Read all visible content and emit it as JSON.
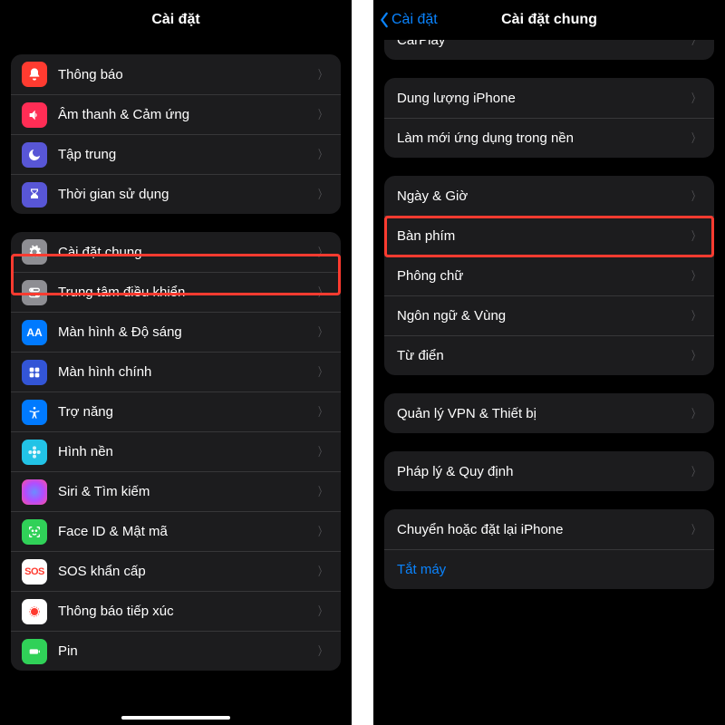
{
  "left": {
    "title": "Cài đặt",
    "group1": [
      {
        "key": "notifications",
        "label": "Thông báo",
        "iconBg": "#ff3b30",
        "glyph": "bell"
      },
      {
        "key": "sound-haptics",
        "label": "Âm thanh & Cảm ứng",
        "iconBg": "#ff2d55",
        "glyph": "speaker"
      },
      {
        "key": "focus",
        "label": "Tập trung",
        "iconBg": "#5856d6",
        "glyph": "moon"
      },
      {
        "key": "screentime",
        "label": "Thời gian sử dụng",
        "iconBg": "#5856d6",
        "glyph": "hourglass"
      }
    ],
    "group2": [
      {
        "key": "general",
        "label": "Cài đặt chung",
        "iconBg": "#8e8e93",
        "glyph": "gear",
        "highlight": true
      },
      {
        "key": "control-center",
        "label": "Trung tâm điều khiển",
        "iconBg": "#8e8e93",
        "glyph": "switches"
      },
      {
        "key": "display",
        "label": "Màn hình & Độ sáng",
        "iconBg": "#007aff",
        "glyph": "AA"
      },
      {
        "key": "home-screen",
        "label": "Màn hình chính",
        "iconBg": "#3355d6",
        "glyph": "grid"
      },
      {
        "key": "accessibility",
        "label": "Trợ năng",
        "iconBg": "#007aff",
        "glyph": "person"
      },
      {
        "key": "wallpaper",
        "label": "Hình nền",
        "iconBg": "#22c3e6",
        "glyph": "flower"
      },
      {
        "key": "siri",
        "label": "Siri & Tìm kiếm",
        "iconBg": "#1c1c1e",
        "glyph": "siri"
      },
      {
        "key": "faceid",
        "label": "Face ID & Mật mã",
        "iconBg": "#30d158",
        "glyph": "face"
      },
      {
        "key": "sos",
        "label": "SOS khẩn cấp",
        "iconBg": "#ffffff",
        "glyph": "sos"
      },
      {
        "key": "exposure",
        "label": "Thông báo tiếp xúc",
        "iconBg": "#ff3b30",
        "glyph": "exposure"
      },
      {
        "key": "battery",
        "label": "Pin",
        "iconBg": "#30d158",
        "glyph": "battery"
      }
    ]
  },
  "right": {
    "back": "Cài đặt",
    "title": "Cài đặt chung",
    "groupTopCut": [
      {
        "key": "carplay",
        "label": "CarPlay"
      }
    ],
    "groupStorage": [
      {
        "key": "iphone-storage",
        "label": "Dung lượng iPhone"
      },
      {
        "key": "background-refresh",
        "label": "Làm mới ứng dụng trong nền"
      }
    ],
    "groupLang": [
      {
        "key": "date-time",
        "label": "Ngày & Giờ"
      },
      {
        "key": "keyboard",
        "label": "Bàn phím",
        "highlight": true
      },
      {
        "key": "fonts",
        "label": "Phông chữ"
      },
      {
        "key": "language-region",
        "label": "Ngôn ngữ & Vùng"
      },
      {
        "key": "dictionary",
        "label": "Từ điển"
      }
    ],
    "groupVpn": [
      {
        "key": "vpn-device",
        "label": "Quản lý VPN & Thiết bị"
      }
    ],
    "groupLegal": [
      {
        "key": "legal",
        "label": "Pháp lý & Quy định"
      }
    ],
    "groupReset": [
      {
        "key": "transfer-reset",
        "label": "Chuyển hoặc đặt lại iPhone"
      },
      {
        "key": "shutdown",
        "label": "Tắt máy",
        "link": true,
        "noChevron": true
      }
    ]
  }
}
